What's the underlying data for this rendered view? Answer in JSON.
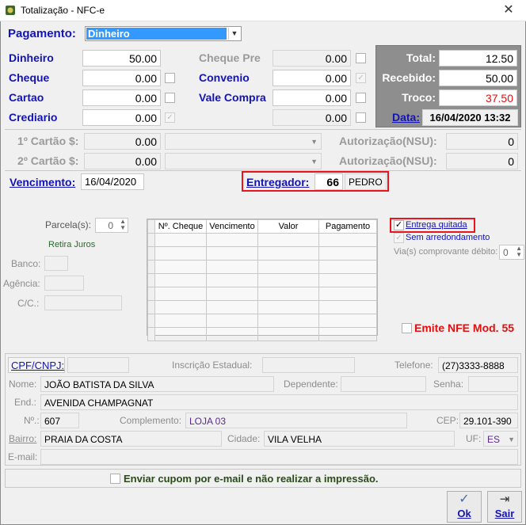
{
  "window": {
    "title": "Totalização - NFC-e"
  },
  "pagamento": {
    "label": "Pagamento:",
    "selected": "Dinheiro"
  },
  "left_fields": [
    {
      "label": "Dinheiro",
      "value": "50.00"
    },
    {
      "label": "Cheque",
      "value": "0.00"
    },
    {
      "label": "Cartao",
      "value": "0.00"
    },
    {
      "label": "Crediario",
      "value": "0.00"
    }
  ],
  "mid_fields": [
    {
      "label": "Cheque Pre",
      "value": "0.00"
    },
    {
      "label": "Convenio",
      "value": "0.00"
    },
    {
      "label": "Vale Compra",
      "value": "0.00"
    },
    {
      "label": "",
      "value": "0.00"
    }
  ],
  "totals": {
    "total_label": "Total:",
    "total_value": "12.50",
    "recebido_label": "Recebido:",
    "recebido_value": "50.00",
    "troco_label": "Troco:",
    "troco_value": "37.50",
    "data_label": "Data:",
    "data_value": "16/04/2020 13:32"
  },
  "cartao": {
    "c1_label": "1º Cartão $:",
    "c1_value": "0.00",
    "c2_label": "2º Cartão $:",
    "c2_value": "0.00",
    "aut1_label": "Autorização(NSU):",
    "aut1_value": "0",
    "aut2_label": "Autorização(NSU):",
    "aut2_value": "0"
  },
  "vencimento": {
    "label": "Vencimento:",
    "value": "16/04/2020"
  },
  "entregador": {
    "label": "Entregador:",
    "code": "66",
    "name": "PEDRO"
  },
  "parcelas": {
    "label": "Parcela(s):",
    "value": "0",
    "retira_juros": "Retira Juros"
  },
  "bank": {
    "banco": "Banco:",
    "agencia": "Agência:",
    "cc": "C/C.:"
  },
  "cheque_table": {
    "headers": [
      "Nº. Cheque",
      "Vencimento",
      "Valor",
      "Pagamento"
    ]
  },
  "options": {
    "entrega_quitada": "Entrega quitada",
    "sem_arredondamento": "Sem arredondamento",
    "vias_label": "Via(s) comprovante débito:",
    "vias_value": "0",
    "emite_nfe": "Emite NFE Mod. 55"
  },
  "cliente": {
    "cpf_label": "CPF/CNPJ:",
    "ie_label": "Inscrição Estadual:",
    "telefone_label": "Telefone:",
    "telefone": "(27)3333-8888",
    "nome_label": "Nome:",
    "nome": "JOÃO BATISTA DA SILVA",
    "dependente_label": "Dependente:",
    "senha_label": "Senha:",
    "end_label": "End.:",
    "end": "AVENIDA CHAMPAGNAT",
    "num_label": "Nº.:",
    "num": "607",
    "compl_label": "Complemento:",
    "compl": "LOJA 03",
    "cep_label": "CEP:",
    "cep": "29.101-390",
    "bairro_label": "Bairro:",
    "bairro": "PRAIA DA COSTA",
    "cidade_label": "Cidade:",
    "cidade": "VILA VELHA",
    "uf_label": "UF:",
    "uf": "ES",
    "email_label": "E-mail:"
  },
  "email_option": "Enviar cupom por e-mail e não realizar a impressão.",
  "buttons": {
    "ok": "Ok",
    "sair": "Sair"
  },
  "colors": {
    "label_blue": "#1414b4",
    "troco_red": "#e01010",
    "highlight_red": "#e8151d",
    "panel_gray": "#8e8e8e"
  }
}
